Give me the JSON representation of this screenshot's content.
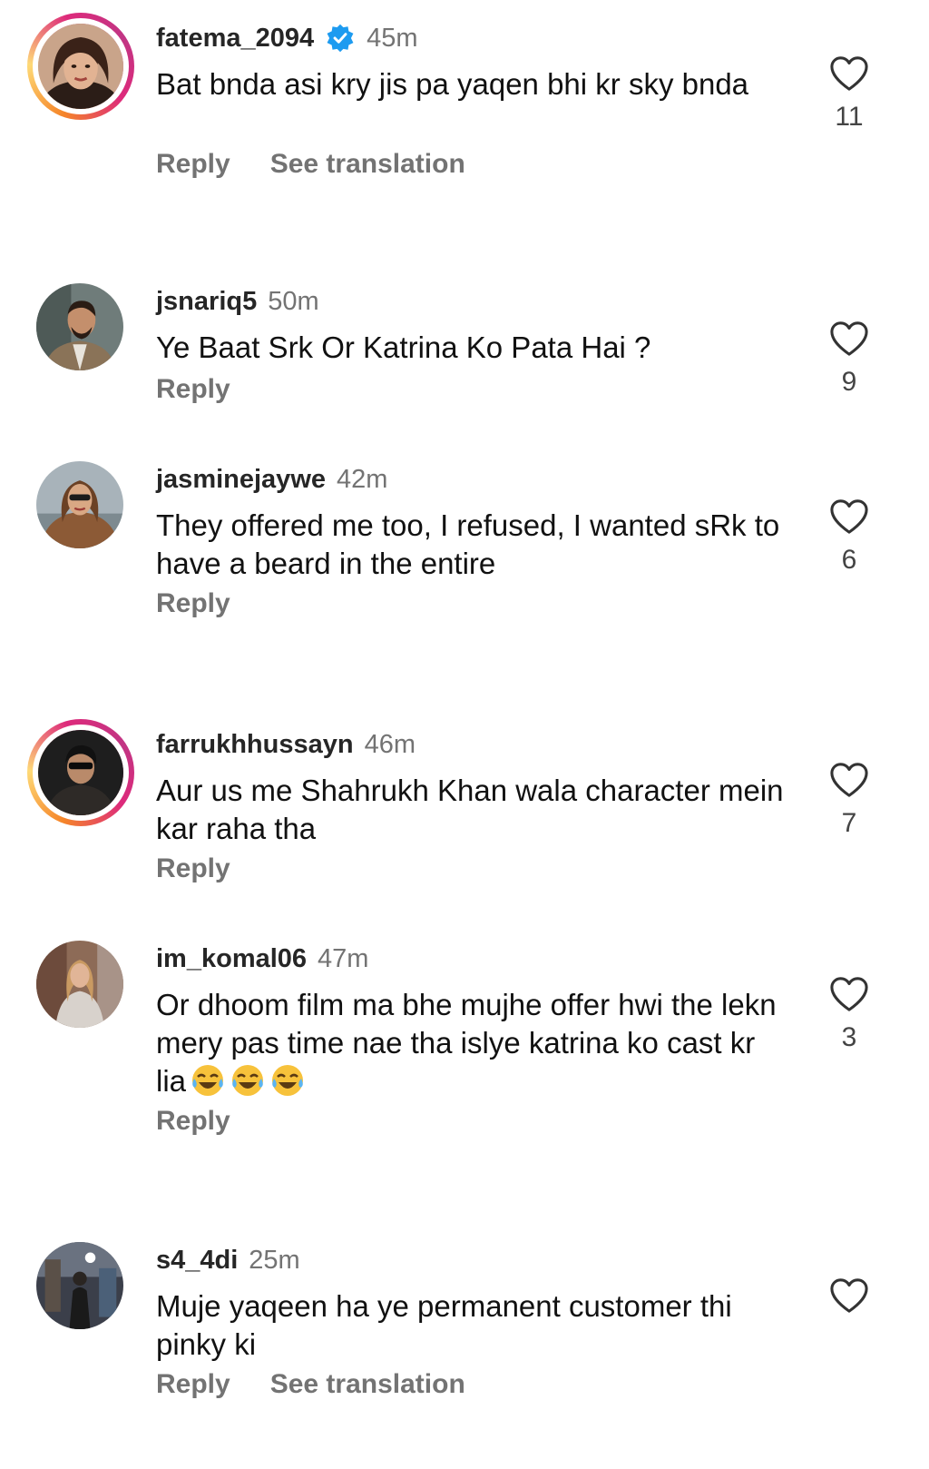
{
  "comments": [
    {
      "username": "fatema_2094",
      "verified": true,
      "time": "45m",
      "text": "Bat bnda asi kry jis pa yaqen bhi kr sky bnda",
      "likes": "11",
      "reply_label": "Reply",
      "translation_label": "See translation",
      "avatar_icon": "avatar-woman-photo",
      "has_story": true
    },
    {
      "username": "jsnariq5",
      "verified": false,
      "time": "50m",
      "text": "Ye Baat Srk Or Katrina Ko Pata Hai ?",
      "likes": "9",
      "reply_label": "Reply",
      "avatar_icon": "avatar-man-suit-photo",
      "has_story": false
    },
    {
      "username": "jasminejaywe",
      "verified": false,
      "time": "42m",
      "text": "They offered me too, I refused, I wanted sRk to have a beard in the entire",
      "likes": "6",
      "reply_label": "Reply",
      "avatar_icon": "avatar-woman-fur-photo",
      "has_story": false
    },
    {
      "username": "farrukhhussayn",
      "verified": false,
      "time": "46m",
      "text": "Aur us me Shahrukh Khan wala character mein kar raha tha",
      "likes": "7",
      "reply_label": "Reply",
      "avatar_icon": "avatar-man-sunglasses-photo",
      "has_story": true
    },
    {
      "username": "im_komal06",
      "verified": false,
      "time": "47m",
      "text": "Or dhoom film ma bhe mujhe offer hwi the lekn mery pas time nae tha islye katrina ko cast kr lia",
      "likes": "3",
      "reply_label": "Reply",
      "avatar_icon": "avatar-woman-street-photo",
      "has_story": false,
      "emoji": "tears-of-joy-emoji"
    },
    {
      "username": "s4_4di",
      "verified": false,
      "time": "25m",
      "text": "Muje yaqeen ha ye permanent customer thi pinky ki",
      "likes": "",
      "reply_label": "Reply",
      "translation_label": "See translation",
      "avatar_icon": "avatar-person-night-photo",
      "has_story": false
    }
  ],
  "colors": {
    "username": "#262626",
    "secondary": "#737373",
    "verified": "#1d9bf0"
  }
}
